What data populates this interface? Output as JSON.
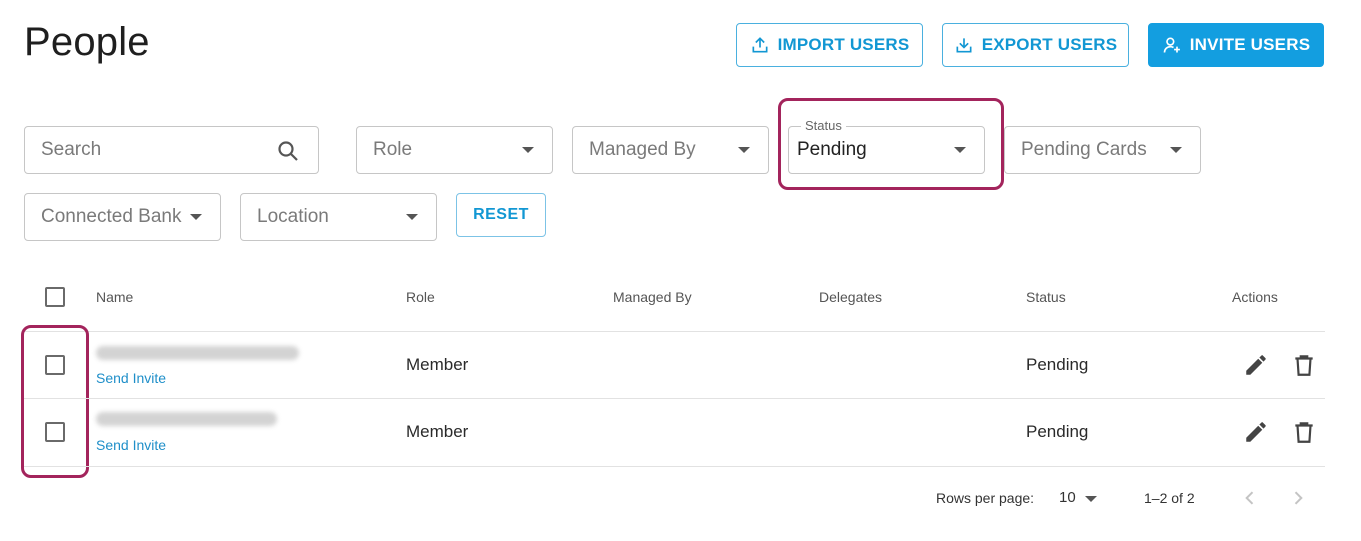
{
  "page": {
    "title": "People"
  },
  "header": {
    "import_label": "IMPORT USERS",
    "export_label": "EXPORT USERS",
    "invite_label": "INVITE USERS"
  },
  "filters": {
    "search_placeholder": "Search",
    "role_placeholder": "Role",
    "managed_by_placeholder": "Managed By",
    "status_label": "Status",
    "status_value": "Pending",
    "pending_cards_placeholder": "Pending Cards",
    "connected_bank_placeholder": "Connected Bank",
    "location_placeholder": "Location",
    "reset_label": "RESET"
  },
  "table": {
    "columns": [
      "Name",
      "Role",
      "Managed By",
      "Delegates",
      "Status",
      "Actions"
    ],
    "rows": [
      {
        "action_link": "Send Invite",
        "role": "Member",
        "status": "Pending"
      },
      {
        "action_link": "Send Invite",
        "role": "Member",
        "status": "Pending"
      }
    ]
  },
  "pagination": {
    "rows_per_page_label": "Rows per page:",
    "rows_per_page_value": "10",
    "range_text": "1–2 of 2"
  },
  "colors": {
    "accent": "#139ee0",
    "highlight": "#a3245c"
  },
  "icons": [
    "upload-icon",
    "download-icon",
    "add-user-icon",
    "search-icon",
    "edit-icon",
    "delete-icon",
    "chevron-left-icon",
    "chevron-right-icon"
  ]
}
